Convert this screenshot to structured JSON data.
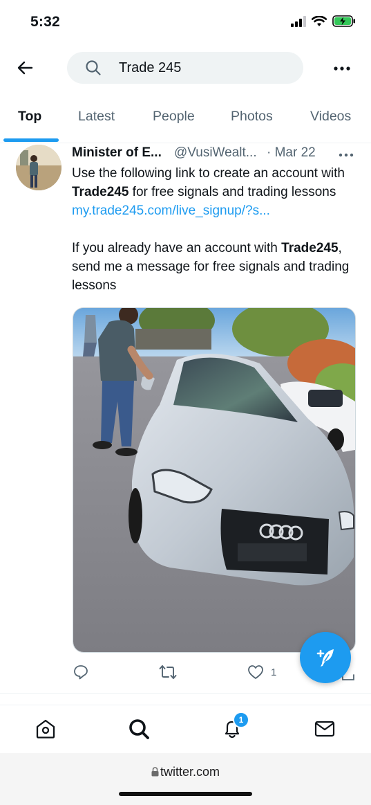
{
  "status_bar": {
    "time": "5:32"
  },
  "search": {
    "query": "Trade 245"
  },
  "tabs": [
    {
      "label": "Top"
    },
    {
      "label": "Latest"
    },
    {
      "label": "People"
    },
    {
      "label": "Photos"
    },
    {
      "label": "Videos"
    }
  ],
  "tweet": {
    "name": "Minister of E...",
    "handle": "@VusiWealt...",
    "date": "· Mar 22",
    "line1a": "Use the following link to create an account with ",
    "line1b": "Trade245",
    "line1c": " for free signals and trading lessons ",
    "link": "my.trade245.com/live_signup/?s...",
    "line2a": "If you already have an account with ",
    "line2b": "Trade245",
    "line2c": ", send me a message for free signals and trading lessons",
    "like_count": "1"
  },
  "notifications": {
    "badge": "1"
  },
  "browser": {
    "url": "twitter.com"
  },
  "colors": {
    "accent": "#1d9bf0",
    "text": "#0f1419",
    "secondary": "#536471"
  }
}
